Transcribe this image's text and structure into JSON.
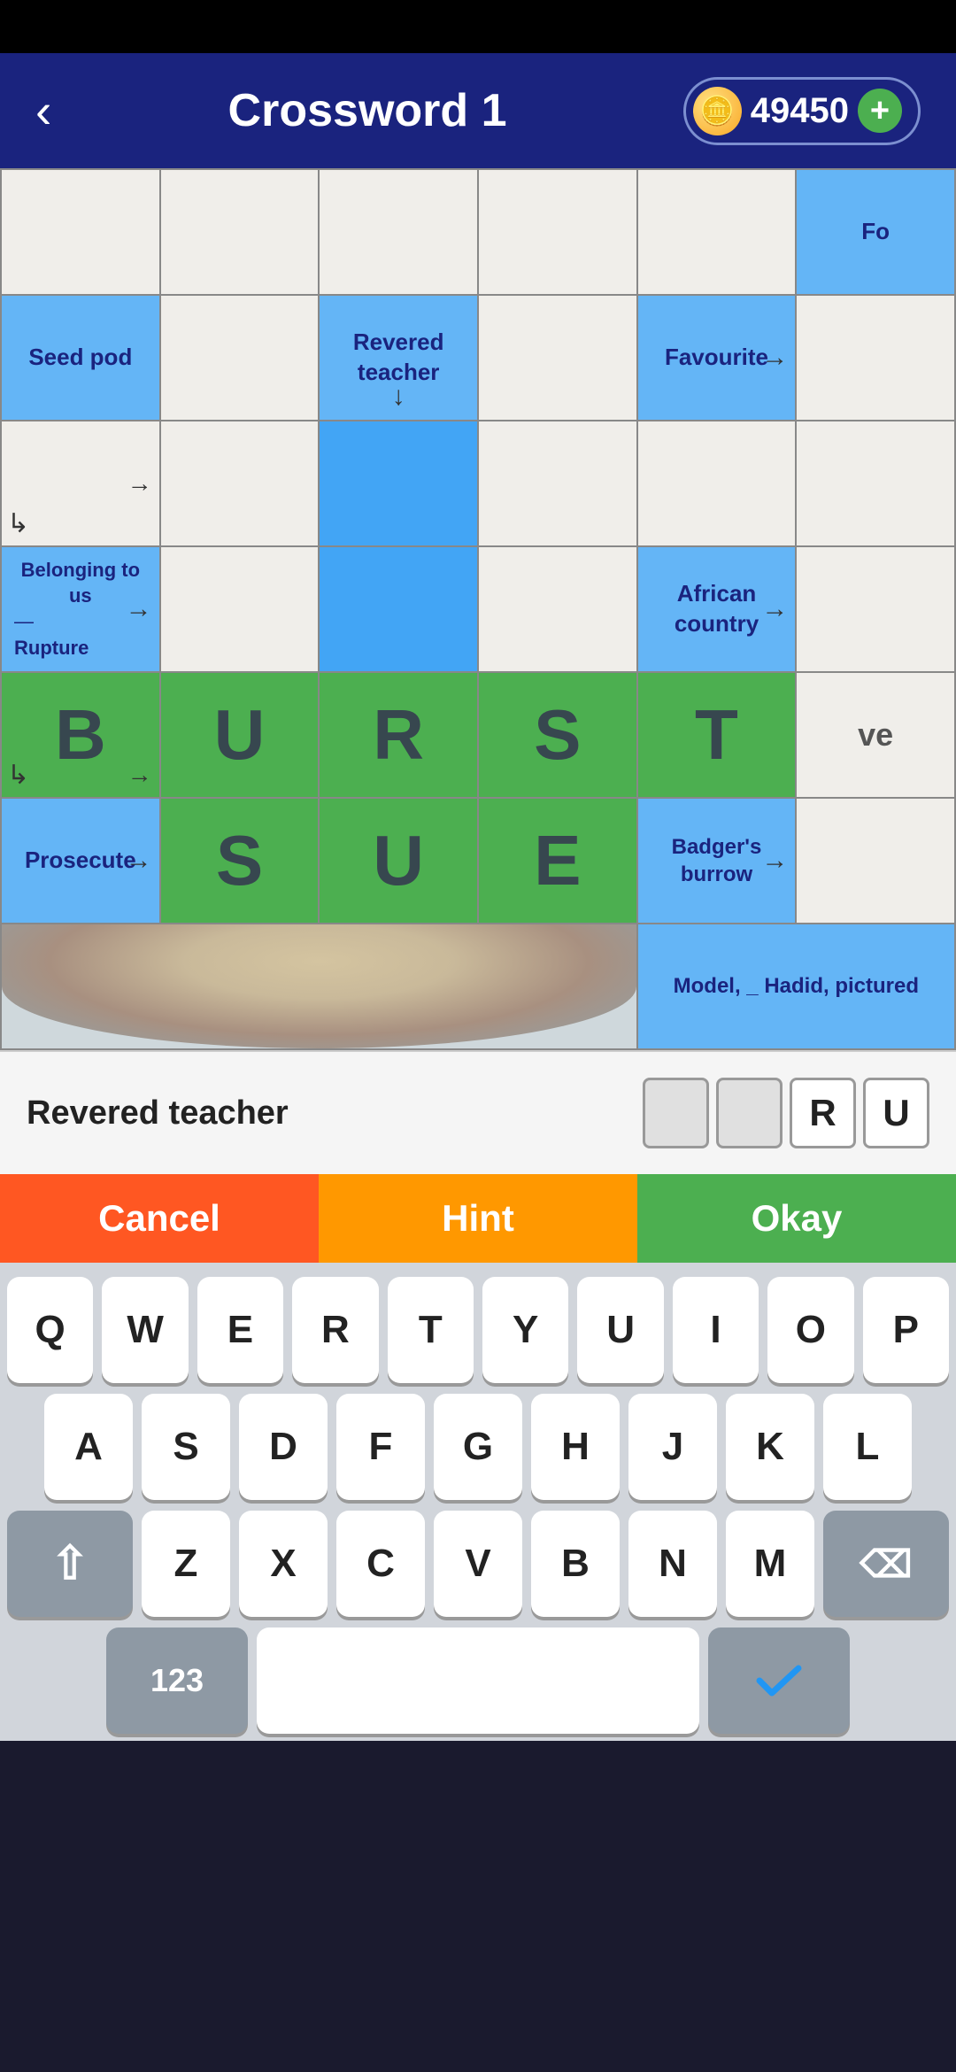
{
  "header": {
    "title": "Crossword 1",
    "back_label": "‹",
    "coins": "49450",
    "plus_label": "+"
  },
  "grid": {
    "rows": 7,
    "cols": 6
  },
  "clues": {
    "seed_pod": "Seed pod",
    "revered_teacher": "Revered teacher",
    "favourite": "Favourite",
    "belonging_to_us": "Belonging to us",
    "rupture": "Rupture",
    "african_country": "African country",
    "prosecute": "Prosecute",
    "badgers_burrow": "Badger's burrow",
    "model_hadid": "Model, _ Hadid, pictured",
    "fo_label": "Fo"
  },
  "letters": {
    "b": "B",
    "u": "U",
    "r": "R",
    "s": "S",
    "t": "T",
    "s2": "S",
    "u2": "U",
    "e": "E",
    "ve": "ve"
  },
  "clue_bar": {
    "label": "Revered teacher",
    "boxes": [
      "",
      "",
      "R",
      "U"
    ]
  },
  "buttons": {
    "cancel": "Cancel",
    "hint": "Hint",
    "okay": "Okay"
  },
  "keyboard": {
    "row1": [
      "Q",
      "W",
      "E",
      "R",
      "T",
      "Y",
      "U",
      "I",
      "O",
      "P"
    ],
    "row2": [
      "A",
      "S",
      "D",
      "F",
      "G",
      "H",
      "J",
      "K",
      "L"
    ],
    "row3": [
      "Z",
      "X",
      "C",
      "V",
      "B",
      "N",
      "M"
    ],
    "num_label": "123"
  }
}
